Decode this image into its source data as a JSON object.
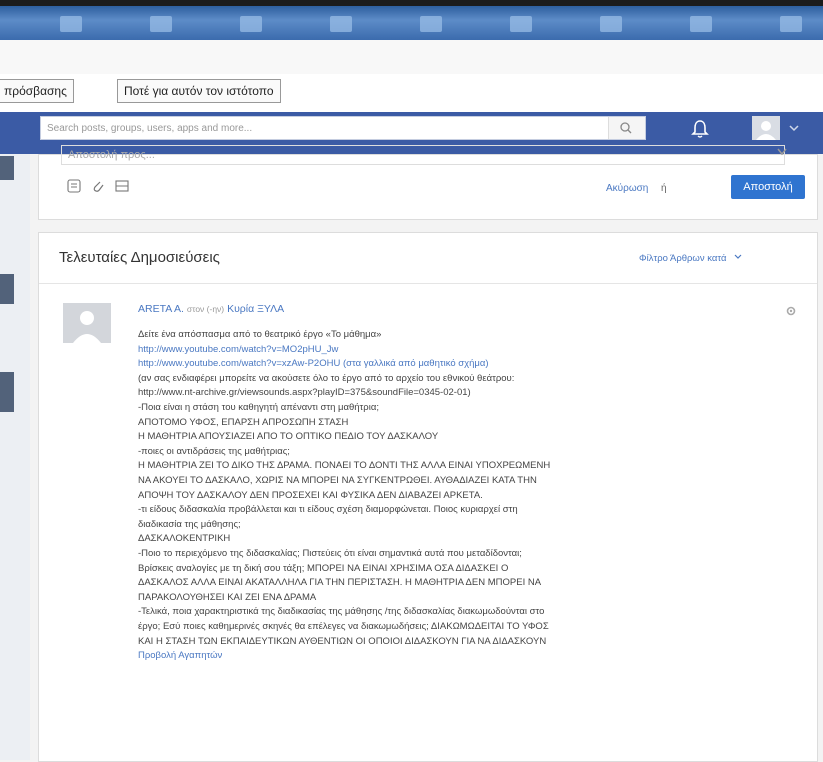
{
  "browser": {
    "link_tabs": [
      "πρόσβασης",
      "Ποτέ για αυτόν τον ιστότοπο"
    ]
  },
  "navbar": {
    "search_placeholder": "Search posts, groups, users, apps and more..."
  },
  "composer": {
    "recipient_placeholder": "Αποστολή προς...",
    "cancel_label": "Ακύρωση",
    "or_label": "ή",
    "send_label": "Αποστολή"
  },
  "feed": {
    "title": "Τελευταίες Δημοσιεύσεις",
    "filter_label": "Φίλτρο Άρθρων κατά"
  },
  "post": {
    "author": "ARETA A.",
    "to_label": "στον (-ην)",
    "recipient": "Κυρία ΞΥΛΑ",
    "lines": [
      {
        "text": "Δείτε ένα απόσπασμα από το θεατρικό έργο «Το μάθημα»",
        "link": false
      },
      {
        "text": "http://www.youtube.com/watch?v=MO2pHU_Jw",
        "link": true
      },
      {
        "text": "http://www.youtube.com/watch?v=xzAw-P2OHU (στα γαλλικά από μαθητικό σχήμα)",
        "link": true
      },
      {
        "text": "(αν σας ενδιαφέρει μπορείτε να ακούσετε όλο το έργο από το αρχείο του εθνικού θεάτρου:",
        "link": false
      },
      {
        "text": "http://www.nt-archive.gr/viewsounds.aspx?playID=375&soundFile=0345-02-01)",
        "link": false
      },
      {
        "text": "-Ποια είναι η στάση του καθηγητή απέναντι στη μαθήτρια;",
        "link": false
      },
      {
        "text": "ΑΠΟΤΟΜΟ ΥΦΟΣ, ΕΠΑΡΣΗ ΑΠΡΟΣΩΠΗ ΣΤΑΣΗ",
        "link": false
      },
      {
        "text": "Η ΜΑΘΗΤΡΙΑ ΑΠΟΥΣΙΑΖΕΙ ΑΠΟ ΤΟ ΟΠΤΙΚΟ ΠΕΔΙΟ ΤΟΥ ΔΑΣΚΑΛΟΥ",
        "link": false
      },
      {
        "text": "-ποιες οι αντιδράσεις της μαθήτριας;",
        "link": false
      },
      {
        "text": "Η ΜΑΘΗΤΡΙΑ ΖΕΙ ΤΟ ΔΙΚΟ ΤΗΣ ΔΡΑΜΑ. ΠΟΝΑΕΙ ΤΟ ΔΟΝΤΙ ΤΗΣ ΑΛΛΑ ΕΙΝΑΙ ΥΠΟΧΡΕΩΜΕΝΗ",
        "link": false
      },
      {
        "text": "ΝΑ ΑΚΟΥΕΙ ΤΟ ΔΑΣΚΑΛΟ, ΧΩΡΙΣ ΝΑ ΜΠΟΡΕΙ ΝΑ ΣΥΓΚΕΝΤΡΩΘΕΙ. ΑΥΘΑΔΙΑΖΕΙ ΚΑΤΑ ΤΗΝ",
        "link": false
      },
      {
        "text": "ΑΠΟΨΗ ΤΟΥ ΔΑΣΚΑΛΟΥ ΔΕΝ ΠΡΟΣΕΧΕΙ ΚΑΙ ΦΥΣΙΚΑ ΔΕΝ ΔΙΑΒΑΖΕΙ ΑΡΚΕΤΑ.",
        "link": false
      },
      {
        "text": "-τι είδους διδασκαλία προβάλλεται και τι είδους σχέση διαμορφώνεται. Ποιος κυριαρχεί στη",
        "link": false
      },
      {
        "text": "διαδικασία της μάθησης;",
        "link": false
      },
      {
        "text": "ΔΑΣΚΑΛΟΚΕΝΤΡΙΚΗ",
        "link": false
      },
      {
        "text": "-Ποιο το περιεχόμενο της διδασκαλίας; Πιστεύεις ότι είναι σημαντικά αυτά που μεταδίδονται;",
        "link": false
      },
      {
        "text": "Βρίσκεις αναλογίες με τη δική σου τάξη; ΜΠΟΡΕΙ ΝΑ ΕΙΝΑΙ ΧΡΗΣΙΜΑ ΟΣΑ ΔΙΔΑΣΚΕΙ Ο",
        "link": false
      },
      {
        "text": "ΔΑΣΚΑΛΟΣ ΑΛΛΑ ΕΙΝΑΙ ΑΚΑΤΑΛΛΗΛΑ ΓΙΑ ΤΗΝ ΠΕΡΙΣΤΑΣΗ. Η ΜΑΘΗΤΡΙΑ ΔΕΝ ΜΠΟΡΕΙ ΝΑ",
        "link": false
      },
      {
        "text": "ΠΑΡΑΚΟΛΟΥΘΗΣΕΙ ΚΑΙ ΖΕΙ ΕΝΑ ΔΡΑΜΑ",
        "link": false
      },
      {
        "text": "-Τελικά, ποια χαρακτηριστικά της διαδικασίας της μάθησης /της διδασκαλίας διακωμωδούνται στο",
        "link": false
      },
      {
        "text": "έργο; Εσύ ποιες καθημερινές σκηνές θα επέλεγες να διακωμωδήσεις; ΔΙΑΚΩΜΩΔΕΙΤΑΙ ΤΟ ΥΦΟΣ",
        "link": false
      },
      {
        "text": "ΚΑΙ Η ΣΤΑΣΗ ΤΩΝ ΕΚΠΑΙΔΕΥΤΙΚΩΝ ΑΥΘΕΝΤΙΩΝ ΟΙ ΟΠΟΙΟΙ ΔΙΔΑΣΚΟΥΝ ΓΙΑ ΝΑ ΔΙΔΑΣΚΟΥΝ",
        "link": false
      },
      {
        "text": "Προβολή Αγαπητών",
        "link": true
      }
    ]
  },
  "colors": {
    "navbar": "#3b5ba5",
    "accent": "#2f74d0",
    "link": "#4a78c2"
  }
}
